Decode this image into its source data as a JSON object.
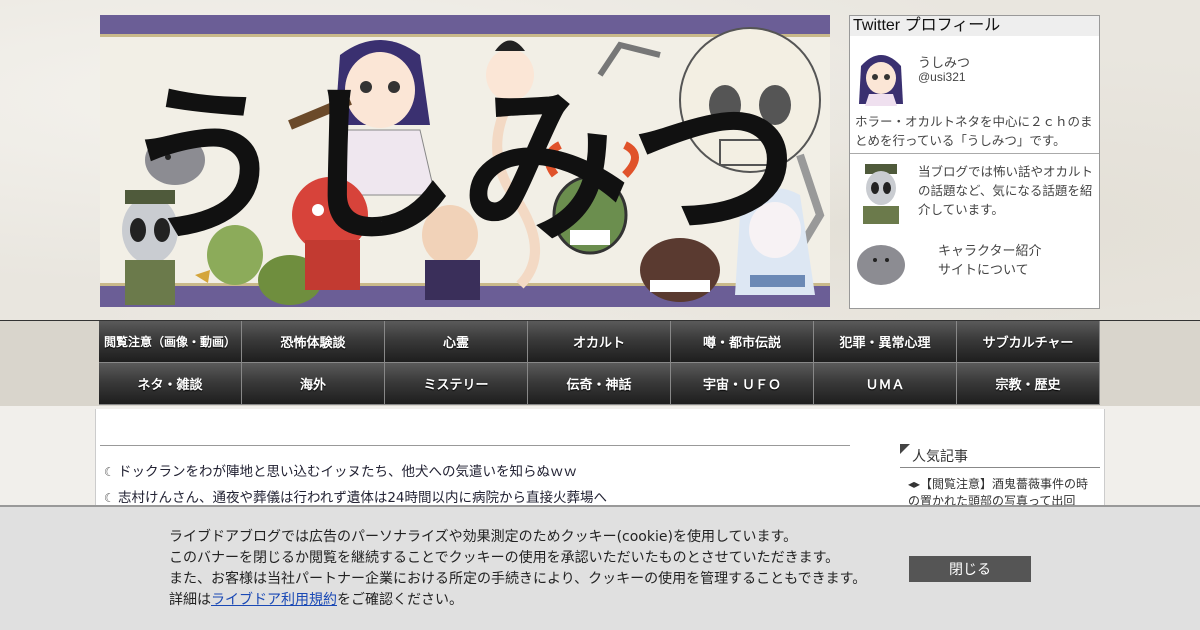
{
  "header": {
    "logo_text": "うしみつ"
  },
  "profile": {
    "title": "Twitter プロフィール",
    "name": "うしみつ",
    "handle": "@usi321",
    "bio": "ホラー・オカルトネタを中心に２ｃｈのまとめを行っている「うしみつ」です。",
    "blog_description": "当ブログでは怖い話やオカルトの話題など、気になる話題を紹介しています。",
    "link_characters": "キャラクター紹介",
    "link_about": "サイトについて"
  },
  "nav": {
    "items": [
      "閲覧注意（画像・動画）",
      "恐怖体験談",
      "心霊",
      "オカルト",
      "噂・都市伝説",
      "犯罪・異常心理",
      "サブカルチャー",
      "ネタ・雑談",
      "海外",
      "ミステリー",
      "伝奇・神話",
      "宇宙・ＵＦＯ",
      "ＵＭＡ",
      "宗教・歴史"
    ]
  },
  "articles": [
    "ドックランをわが陣地と思い込むイッヌたち、他犬への気遣いを知らぬｗｗ",
    "志村けんさん、通夜や葬儀は行われず遺体は24時間以内に病院から直接火葬場へ"
  ],
  "sidebar": {
    "heading": "人気記事",
    "popular_item": "【閲覧注意】酒鬼薔薇事件の時の置かれた頭部の写真って出回"
  },
  "cookie": {
    "line1": "ライブドアブログでは広告のパーソナライズや効果測定のためクッキー(cookie)を使用しています。",
    "line2": "このバナーを閉じるか閲覧を継続することでクッキーの使用を承認いただいたものとさせていただきます。",
    "line3": "また、お客様は当社パートナー企業における所定の手続きにより、クッキーの使用を管理することもできます。",
    "line4_prefix": "詳細は",
    "line4_link": "ライブドア利用規約",
    "line4_suffix": "をご確認ください。",
    "close_label": "閉じる"
  },
  "colors": {
    "nav_bg": "#2a2a2a",
    "banner_stripe": "#6b5e96",
    "close_button": "#555555",
    "link": "#1a49b5"
  }
}
